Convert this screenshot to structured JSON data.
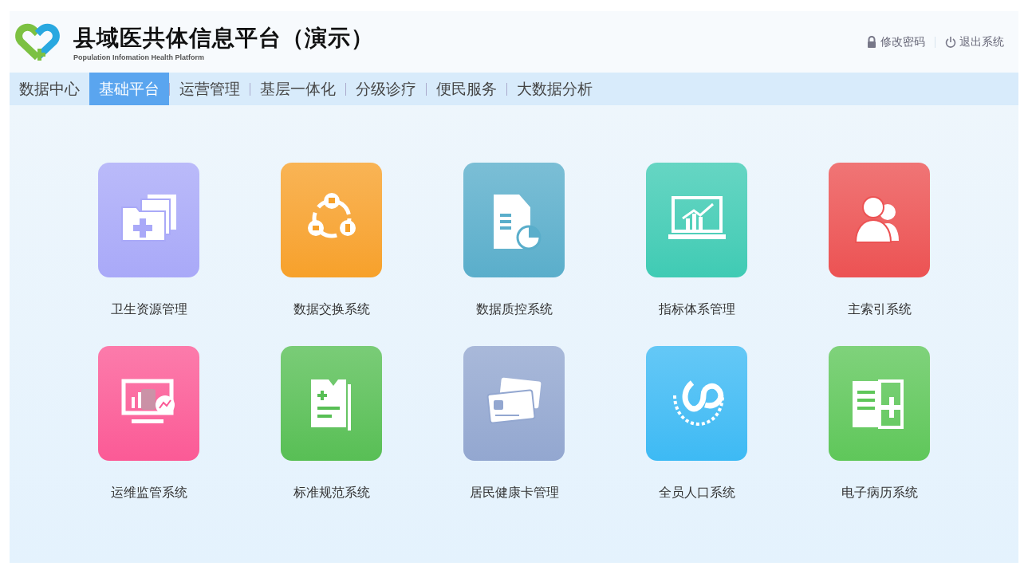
{
  "header": {
    "title": "县域医共体信息平台（演示）",
    "subtitle": "Population Infomation Health Platform",
    "links": [
      {
        "kind": "lock",
        "label": "修改密码"
      },
      {
        "kind": "power",
        "label": "退出系统"
      }
    ]
  },
  "tabs": [
    {
      "label": "数据中心",
      "selected": false
    },
    {
      "label": "基础平台",
      "selected": true
    },
    {
      "label": "运营管理",
      "selected": false
    },
    {
      "label": "基层一体化",
      "selected": false
    },
    {
      "label": "分级诊疗",
      "selected": false
    },
    {
      "label": "便民服务",
      "selected": false
    },
    {
      "label": "大数据分析",
      "selected": false
    }
  ],
  "apps": [
    {
      "label": "卫生资源管理",
      "kind": "folder",
      "color": "#a9a9f8"
    },
    {
      "label": "数据交换系统",
      "kind": "exchange",
      "color": "#f7a12a"
    },
    {
      "label": "数据质控系统",
      "kind": "report",
      "color": "#5aaecb"
    },
    {
      "label": "指标体系管理",
      "kind": "chart",
      "color": "#3fcbb4"
    },
    {
      "label": "主索引系统",
      "kind": "people",
      "color": "#ec5253"
    },
    {
      "label": "运维监管系统",
      "kind": "monitor",
      "color": "#fb5a96"
    },
    {
      "label": "标准规范系统",
      "kind": "document",
      "color": "#58bf55"
    },
    {
      "label": "居民健康卡管理",
      "kind": "card",
      "color": "#93a7d0"
    },
    {
      "label": "全员人口系统",
      "kind": "emblem",
      "color": "#3dbaf4"
    },
    {
      "label": "电子病历系统",
      "kind": "record",
      "color": "#5fc75a"
    }
  ]
}
